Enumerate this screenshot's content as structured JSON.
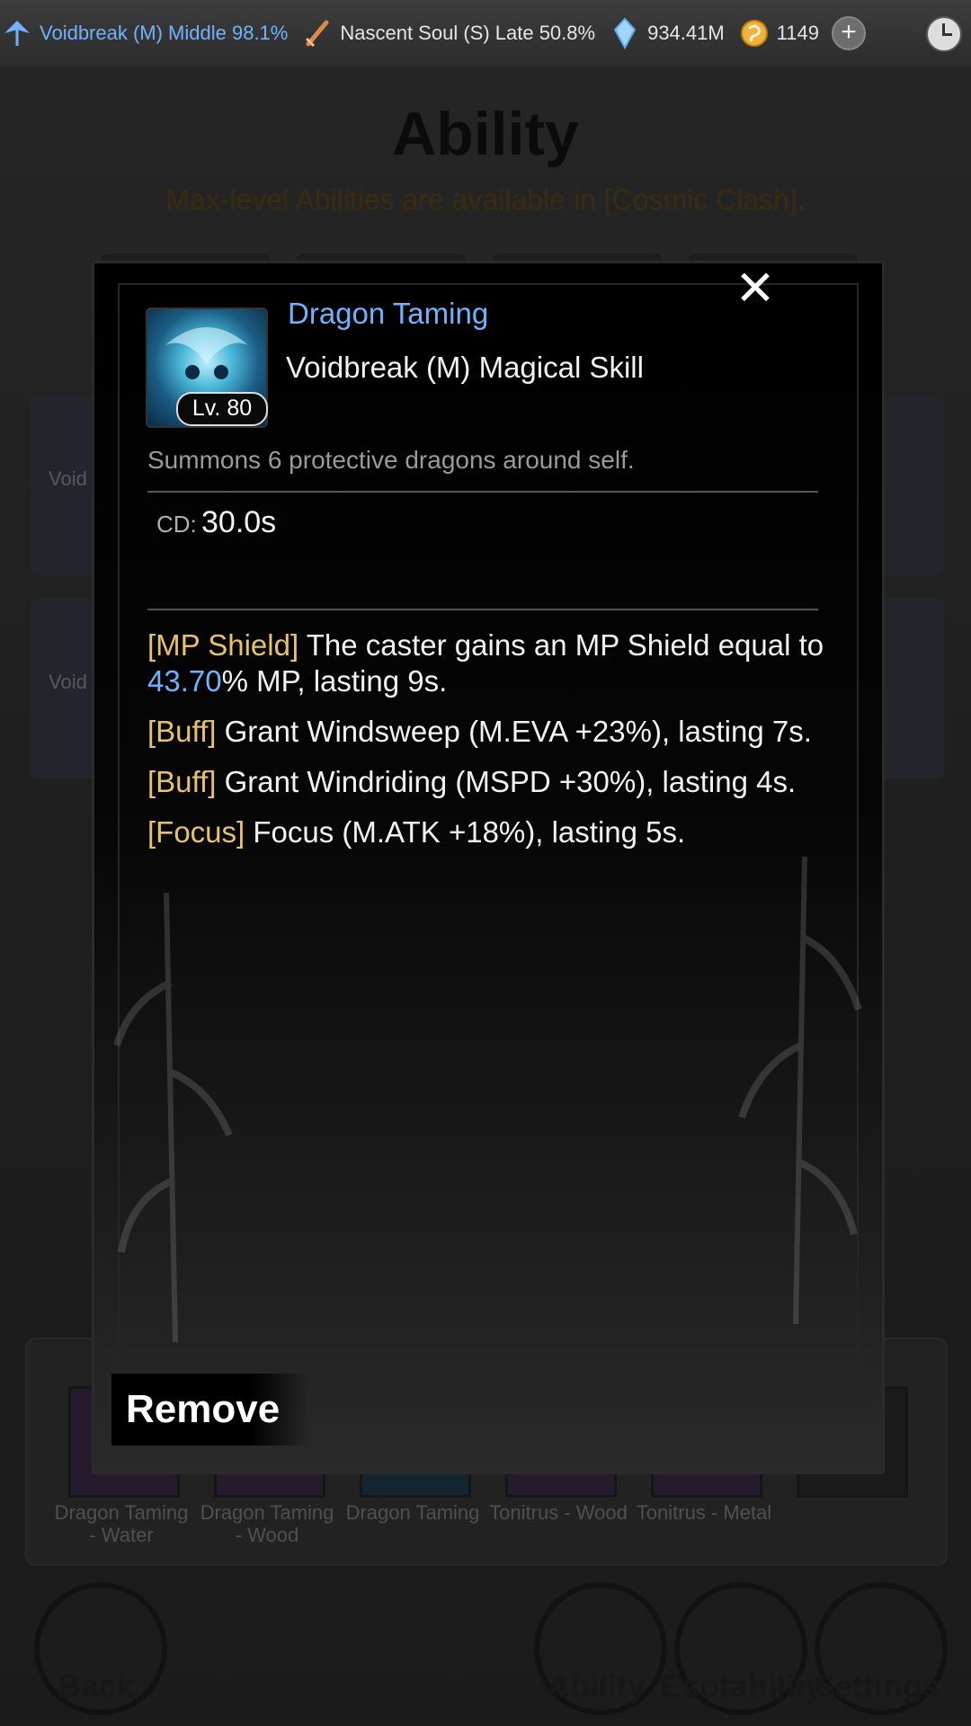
{
  "topbar": {
    "cultivation_realm": "Voidbreak (M) Middle 98.1%",
    "body_realm": "Nascent Soul (S) Late 50.8%",
    "spirit_stones": "934.41M",
    "gold": "1149",
    "plus_label": "+"
  },
  "page": {
    "title": "Ability",
    "subtitle": "Max-level Abilities are available in [Cosmic Clash].",
    "card_labels": [
      "Void",
      "Void"
    ]
  },
  "equipped_skills": [
    {
      "label": "Dragon Taming - Water"
    },
    {
      "label": "Dragon Taming - Wood"
    },
    {
      "label": "Dragon Taming"
    },
    {
      "label": "Tonitrus - Wood"
    },
    {
      "label": "Tonitrus - Metal"
    }
  ],
  "nav": {
    "back": "Back",
    "ability": "Ability",
    "esotability": "Esotability",
    "settings": "Settings"
  },
  "modal": {
    "close": "✕",
    "level": "Lv. 80",
    "skill_name": "Dragon Taming",
    "skill_type": "Voidbreak (M) Magical Skill",
    "description": "Summons 6 protective dragons around self.",
    "cd_label": "CD:",
    "cd_value": "30.0s",
    "effects": [
      {
        "tag": "[MP Shield]",
        "pre": " The caster gains an MP Shield equal to ",
        "num": "43.70",
        "post": "% MP, lasting 9s."
      },
      {
        "tag": "[Buff]",
        "pre": " Grant Windsweep (M.EVA +23%), lasting 7s.",
        "num": "",
        "post": ""
      },
      {
        "tag": "[Buff]",
        "pre": " Grant Windriding (MSPD +30%), lasting 4s.",
        "num": "",
        "post": ""
      },
      {
        "tag": "[Focus]",
        "pre": " Focus (M.ATK +18%), lasting 5s.",
        "num": "",
        "post": ""
      }
    ],
    "remove_label": "Remove"
  },
  "colors": {
    "accent_blue": "#6fb3ff",
    "tag_gold": "#e8c26a"
  },
  "icons": [
    "fan-icon",
    "sword-icon",
    "crystal-icon",
    "gold-coin-icon",
    "plus-icon",
    "clock-icon",
    "close-icon",
    "dragon-skill-icon"
  ]
}
